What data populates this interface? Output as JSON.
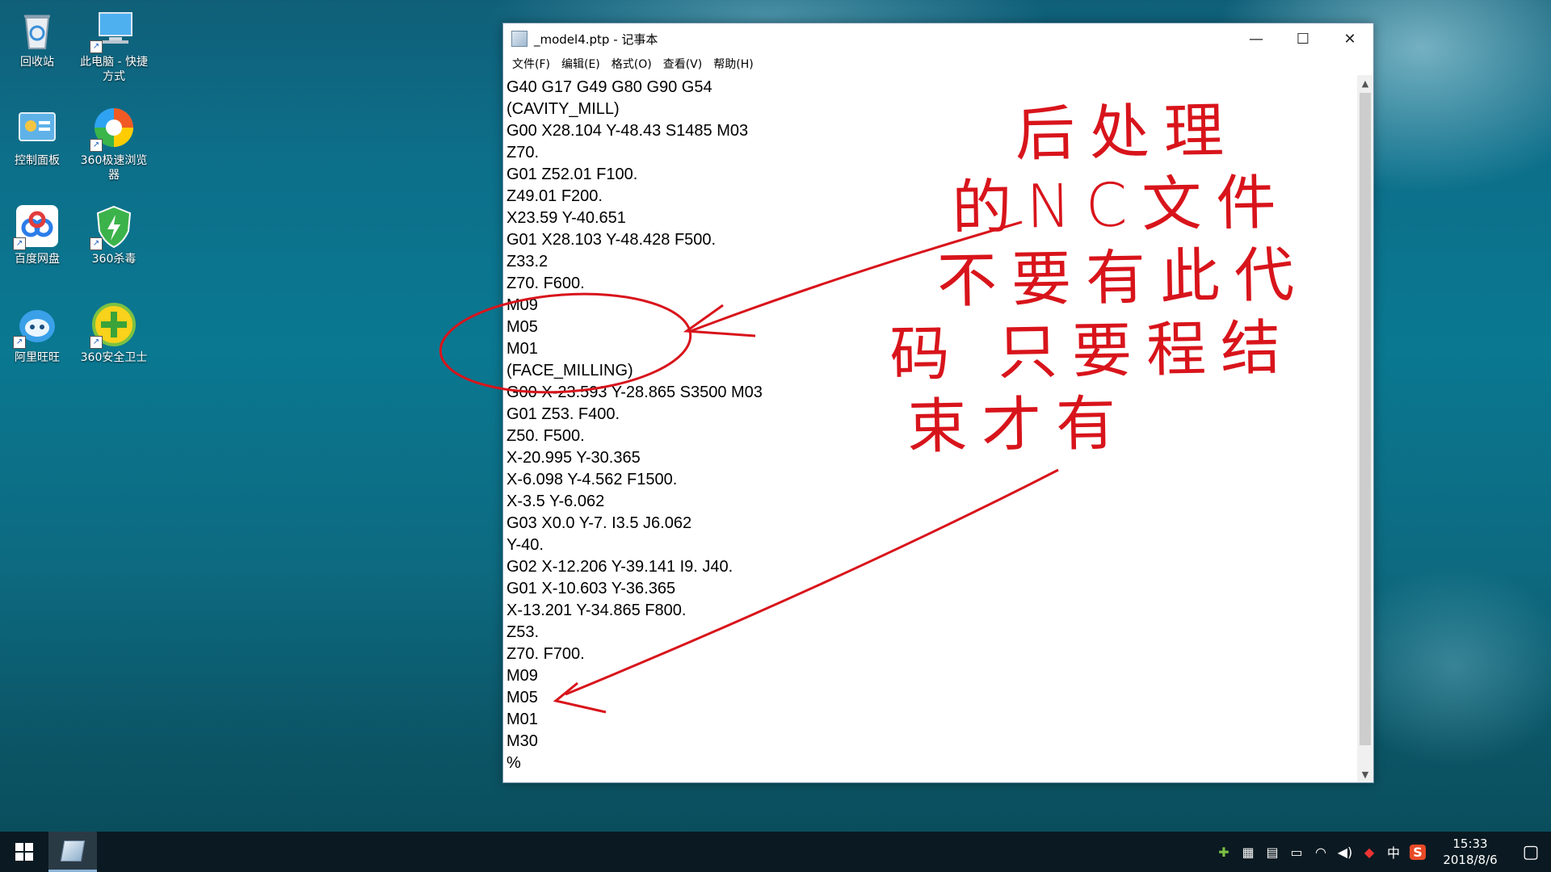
{
  "desktop": {
    "icons": [
      {
        "label": "回收站",
        "icon": "recycle-bin-icon"
      },
      {
        "label": "此电脑 - 快捷\n方式",
        "icon": "computer-icon"
      },
      {
        "label": "控制面板",
        "icon": "control-panel-icon"
      },
      {
        "label": "360极速浏览\n器",
        "icon": "browser-icon"
      },
      {
        "label": "百度网盘",
        "icon": "baidu-netdisk-icon"
      },
      {
        "label": "360杀毒",
        "icon": "antivirus-icon"
      },
      {
        "label": "阿里旺旺",
        "icon": "aliwangwang-icon"
      },
      {
        "label": "360安全卫士",
        "icon": "security-guard-icon"
      }
    ]
  },
  "window": {
    "title": "_model4.ptp - 记事本",
    "controls": {
      "minimize": "—",
      "maximize": "☐",
      "close": "✕"
    },
    "menu": [
      "文件(F)",
      "编辑(E)",
      "格式(O)",
      "查看(V)",
      "帮助(H)"
    ],
    "lines": [
      "G40 G17 G49 G80 G90 G54",
      "(CAVITY_MILL)",
      "G00 X28.104 Y-48.43 S1485 M03",
      "Z70.",
      "G01 Z52.01 F100.",
      "Z49.01 F200.",
      "X23.59 Y-40.651",
      "G01 X28.103 Y-48.428 F500.",
      "Z33.2",
      "Z70. F600.",
      "M09",
      "M05",
      "M01",
      "(FACE_MILLING)",
      "G00 X-23.593 Y-28.865 S3500 M03",
      "G01 Z53. F400.",
      "Z50. F500.",
      "X-20.995 Y-30.365",
      "X-6.098 Y-4.562 F1500.",
      "X-3.5 Y-6.062",
      "G03 X0.0 Y-7. I3.5 J6.062",
      "Y-40.",
      "G02 X-12.206 Y-39.141 I9. J40.",
      "G01 X-10.603 Y-36.365",
      "X-13.201 Y-34.865 F800.",
      "Z53.",
      "Z70. F700.",
      "M09",
      "M05",
      "M01",
      "M30",
      "%"
    ]
  },
  "annotation": {
    "color": "#d8141b",
    "lines": [
      "后处理",
      "的NC文件",
      "不要有此代",
      "码 只要程结",
      "束才有"
    ]
  },
  "taskbar": {
    "tray_ime": "中",
    "time": "15:33",
    "date": "2018/8/6"
  }
}
